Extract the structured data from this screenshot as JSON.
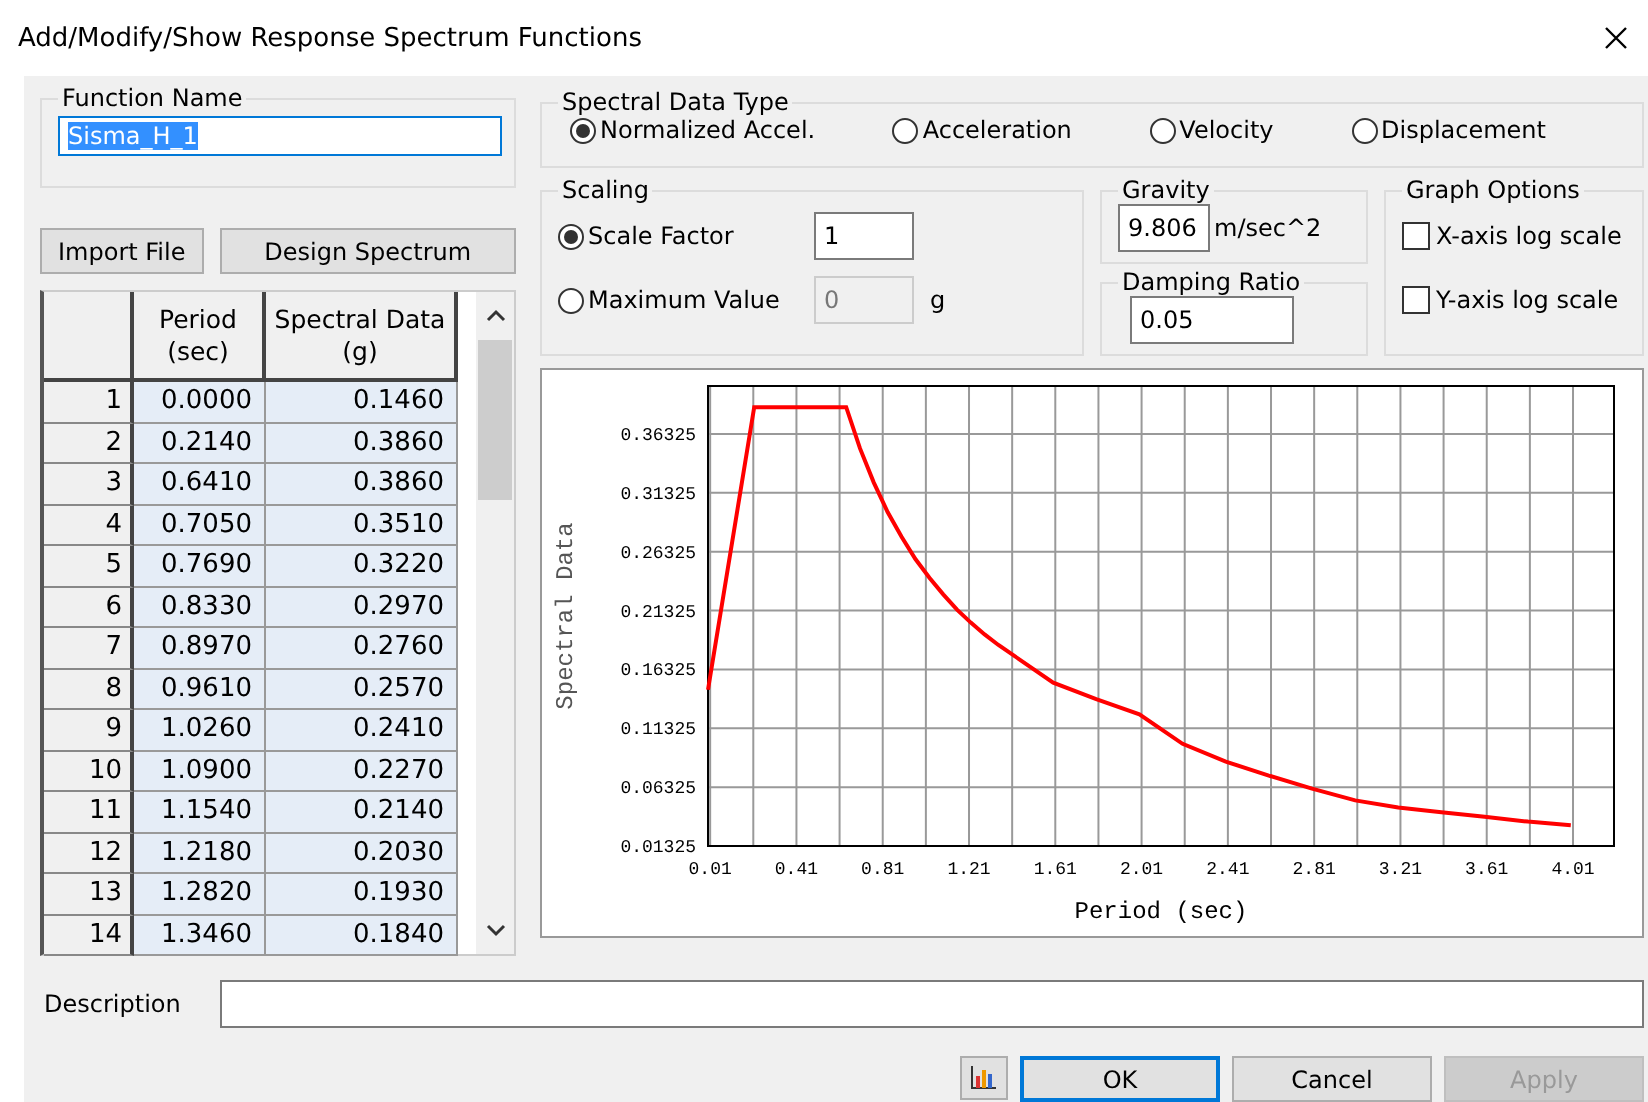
{
  "window": {
    "title": "Add/Modify/Show Response Spectrum Functions"
  },
  "function_name": {
    "label": "Function Name",
    "value": "Sisma_H_1"
  },
  "left_buttons": [
    "Import File",
    "Design Spectrum"
  ],
  "table": {
    "columns": [
      "Period (sec)",
      "Spectral Data (g)"
    ],
    "rows": [
      {
        "number": "1",
        "period": "0.0000",
        "spectral": "0.1460"
      },
      {
        "number": "2",
        "period": "0.2140",
        "spectral": "0.3860"
      },
      {
        "number": "3",
        "period": "0.6410",
        "spectral": "0.3860"
      },
      {
        "number": "4",
        "period": "0.7050",
        "spectral": "0.3510"
      },
      {
        "number": "5",
        "period": "0.7690",
        "spectral": "0.3220"
      },
      {
        "number": "6",
        "period": "0.8330",
        "spectral": "0.2970"
      },
      {
        "number": "7",
        "period": "0.8970",
        "spectral": "0.2760"
      },
      {
        "number": "8",
        "period": "0.9610",
        "spectral": "0.2570"
      },
      {
        "number": "9",
        "period": "1.0260",
        "spectral": "0.2410"
      },
      {
        "number": "10",
        "period": "1.0900",
        "spectral": "0.2270"
      },
      {
        "number": "11",
        "period": "1.1540",
        "spectral": "0.2140"
      },
      {
        "number": "12",
        "period": "1.2180",
        "spectral": "0.2030"
      },
      {
        "number": "13",
        "period": "1.2820",
        "spectral": "0.1930"
      },
      {
        "number": "14",
        "period": "1.3460",
        "spectral": "0.1840"
      }
    ]
  },
  "spectral_data_type": {
    "label": "Spectral Data Type",
    "options": [
      {
        "label": "Normalized Accel.",
        "selected": true
      },
      {
        "label": "Acceleration",
        "selected": false
      },
      {
        "label": "Velocity",
        "selected": false
      },
      {
        "label": "Displacement",
        "selected": false
      }
    ]
  },
  "scaling": {
    "label": "Scaling",
    "options": [
      {
        "label": "Scale Factor",
        "selected": true,
        "value": "1",
        "disabled": false
      },
      {
        "label": "Maximum Value",
        "selected": false,
        "value": "0",
        "unit": "g",
        "disabled": true
      }
    ]
  },
  "gravity": {
    "label": "Gravity",
    "value": "9.806",
    "unit": "m/sec^2"
  },
  "damping": {
    "label": "Damping Ratio",
    "value": "0.05"
  },
  "graph_options": {
    "label": "Graph Options",
    "options": [
      {
        "label": "X-axis log scale",
        "checked": false
      },
      {
        "label": "Y-axis log scale",
        "checked": false
      }
    ]
  },
  "chart": {
    "chart_data": {
      "type": "line",
      "xlabel": "Period (sec)",
      "ylabel": "Spectral Data",
      "x": [
        0,
        0.214,
        0.641,
        0.705,
        0.769,
        0.833,
        0.897,
        0.961,
        1.026,
        1.09,
        1.154,
        1.218,
        1.282,
        1.346,
        1.6,
        1.8,
        2.0,
        2.2,
        2.4,
        2.6,
        2.8,
        3.0,
        3.2,
        3.4,
        3.6,
        3.8,
        4.0
      ],
      "series": [
        {
          "color": "#ff0000",
          "values": [
            0.146,
            0.386,
            0.386,
            0.351,
            0.322,
            0.297,
            0.276,
            0.257,
            0.241,
            0.227,
            0.214,
            0.203,
            0.193,
            0.184,
            0.152,
            0.138,
            0.125,
            0.1,
            0.085,
            0.073,
            0.062,
            0.052,
            0.046,
            0.042,
            0.038,
            0.034,
            0.031
          ]
        }
      ],
      "xlim": [
        0,
        4.2
      ],
      "grid": true,
      "ylim": [
        0.01325,
        0.404
      ],
      "xticks": [
        0.01,
        0.41,
        0.81,
        1.21,
        1.61,
        2.01,
        2.41,
        2.81,
        3.21,
        3.61,
        4.01
      ],
      "yticks": [
        0.01325,
        0.06325,
        0.11325,
        0.16325,
        0.21325,
        0.26325,
        0.31325,
        0.36325
      ]
    }
  },
  "description": {
    "label": "Description"
  },
  "bottom_buttons": [
    {
      "label": "OK",
      "disabled": false
    },
    {
      "label": "Cancel",
      "disabled": false
    },
    {
      "label": "Apply",
      "disabled": true
    }
  ]
}
